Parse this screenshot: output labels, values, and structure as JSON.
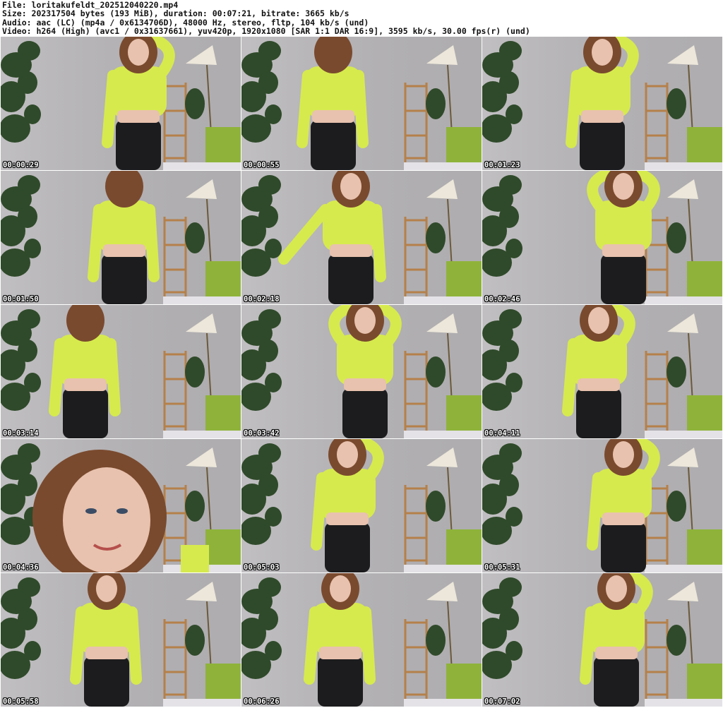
{
  "header": {
    "file_line": "File: loritakufeldt_202512040220.mp4",
    "size_line": "Size: 202317504 bytes (193 MiB), duration: 00:07:21, bitrate: 3665 kb/s",
    "audio_line": "Audio: aac (LC) (mp4a / 0x6134706D), 48000 Hz, stereo, fltp, 104 kb/s (und)",
    "video_line": "Video: h264 (High) (avc1 / 0x31637661), yuv420p, 1920x1080 [SAR 1:1 DAR 16:9], 3595 kb/s, 30.00 fps(r) (und)"
  },
  "frames": [
    {
      "timestamp": "00:00:29"
    },
    {
      "timestamp": "00:00:55"
    },
    {
      "timestamp": "00:01:23"
    },
    {
      "timestamp": "00:01:50"
    },
    {
      "timestamp": "00:02:18"
    },
    {
      "timestamp": "00:02:46"
    },
    {
      "timestamp": "00:03:14"
    },
    {
      "timestamp": "00:03:42"
    },
    {
      "timestamp": "00:04:11"
    },
    {
      "timestamp": "00:04:36"
    },
    {
      "timestamp": "00:05:03"
    },
    {
      "timestamp": "00:05:31"
    },
    {
      "timestamp": "00:05:58"
    },
    {
      "timestamp": "00:06:26"
    },
    {
      "timestamp": "00:07:02"
    }
  ],
  "colors": {
    "wall": "#b8b6b9",
    "top": "#d6ea4e",
    "pants": "#1c1c1e",
    "hair": "#7a4a2e",
    "skin": "#e8c2ae",
    "plant": "#2f4a2a",
    "shelf": "#b5804a",
    "cushion": "#8fb33a",
    "lamp": "#ece7da",
    "couch": "#e4e2e6"
  }
}
